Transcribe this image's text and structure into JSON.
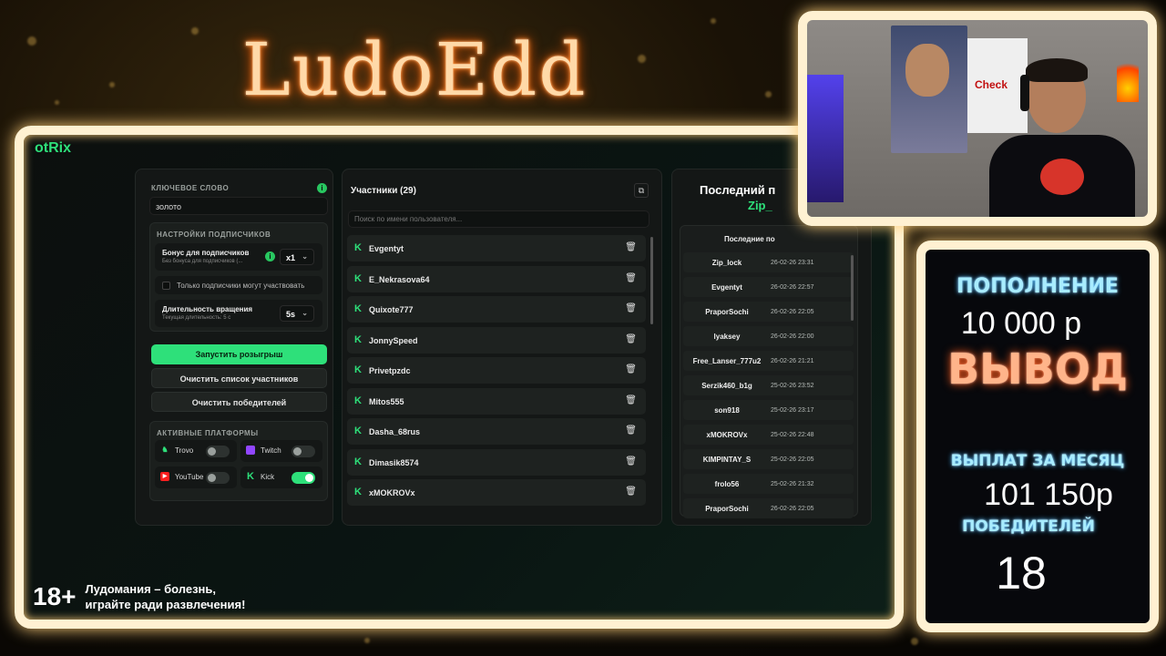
{
  "logo": {
    "text": "LudoEdd"
  },
  "app": {
    "brand": "otRix",
    "left_panel": {
      "keyword_label": "КЛЮЧЕВОЕ СЛОВО",
      "keyword_value": "золото",
      "subscriber_settings_label": "НАСТРОЙКИ ПОДПИСЧИКОВ",
      "bonus_title": "Бонус для подписчиков",
      "bonus_sub": "Без бонуса для подписчиков (...",
      "bonus_select": "x1",
      "only_subs_label": "Только подписчики могут участвовать",
      "spin_title": "Длительность вращения",
      "spin_sub": "Текущая длительность: 5 с",
      "spin_select": "5s",
      "start_button": "Запустить розыгрыш",
      "clear_participants_button": "Очистить список участников",
      "clear_winners_button": "Очистить победителей",
      "platforms_label": "АКТИВНЫЕ ПЛАТФОРМЫ",
      "platforms": [
        {
          "name": "Trovo",
          "enabled": false,
          "color": "#2ee07a"
        },
        {
          "name": "Twitch",
          "enabled": false,
          "color": "#9146ff"
        },
        {
          "name": "YouTube",
          "enabled": false,
          "color": "#ff1f1f"
        },
        {
          "name": "Kick",
          "enabled": true,
          "color": "#2ee07a"
        }
      ]
    },
    "participants": {
      "title": "Участники (29)",
      "search_placeholder": "Поиск по имени пользователя...",
      "items": [
        "Evgentyt",
        "E_Nekrasova64",
        "Quixote777",
        "JonnySpeed",
        "Privetpzdc",
        "Mitos555",
        "Dasha_68rus",
        "Dimasik8574",
        "xMOKROVx"
      ]
    },
    "winners": {
      "title": "Последний п",
      "last_winner": "Zip_",
      "list_header": "Последние по",
      "items": [
        {
          "name": "Zip_lock",
          "date": "26-02-26 23:31"
        },
        {
          "name": "Evgentyt",
          "date": "26-02-26 22:57"
        },
        {
          "name": "PraporSochi",
          "date": "26-02-26 22:05"
        },
        {
          "name": "lyaksey",
          "date": "26-02-26 22:00"
        },
        {
          "name": "Free_Lanser_777u2",
          "date": "26-02-26 21:21"
        },
        {
          "name": "Serzik460_b1g",
          "date": "25-02-26 23:52"
        },
        {
          "name": "son918",
          "date": "25-02-26 23:17"
        },
        {
          "name": "xMOKROVx",
          "date": "25-02-26 22:48"
        },
        {
          "name": "KIMPINTAY_S",
          "date": "25-02-26 22:05"
        },
        {
          "name": "frolo56",
          "date": "25-02-26 21:32"
        },
        {
          "name": "PraporSochi",
          "date": "26-02-26 22:05"
        }
      ]
    },
    "warning": {
      "age": "18+",
      "line1": "Лудомания – болезнь,",
      "line2": "играйте ради развлечения!"
    }
  },
  "cam": {
    "poster_text": "Check"
  },
  "stats": {
    "deposit_label": "ПОПОЛНЕНИЕ",
    "deposit_value": "10 000 р",
    "withdraw_label": "ВЫВОД",
    "payouts_label": "ВЫПЛАТ ЗА МЕСЯЦ",
    "payouts_value": "101 150р",
    "winners_label": "ПОБЕДИТЕЛЕЙ",
    "winners_value": "18"
  }
}
